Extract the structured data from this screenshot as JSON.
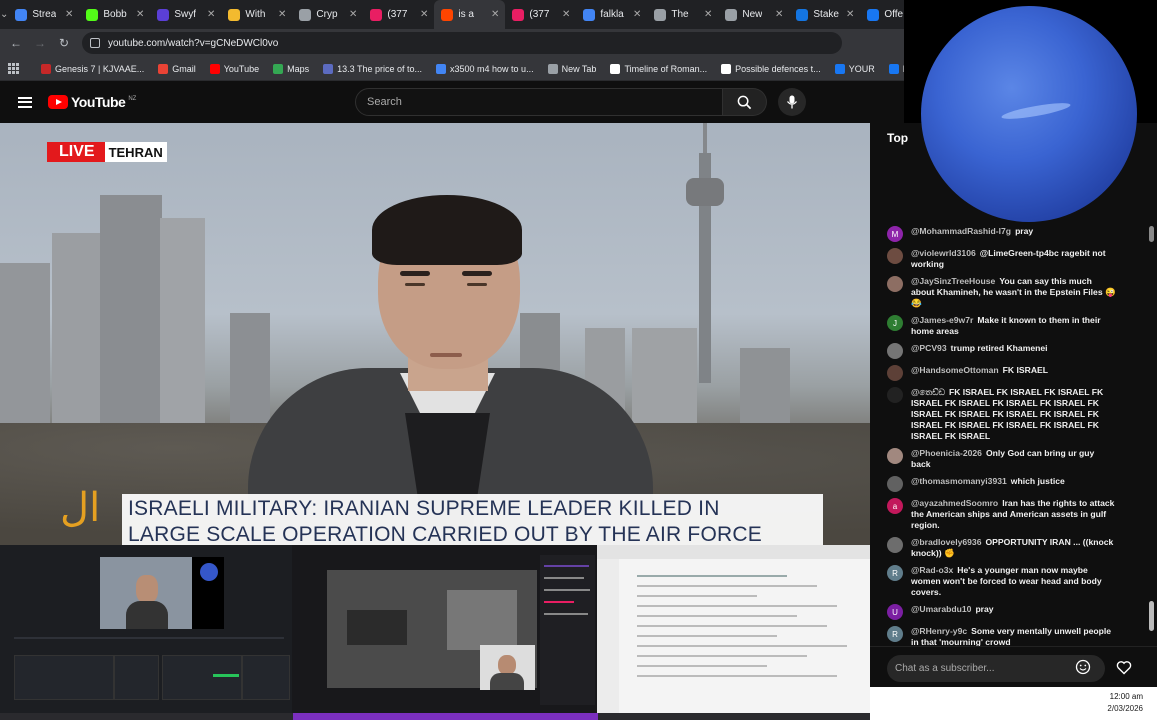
{
  "browser": {
    "tabs": [
      {
        "label": "Strea",
        "color": "#4285f4"
      },
      {
        "label": "Bobb",
        "color": "#53fc18"
      },
      {
        "label": "Swyf",
        "color": "#5b3fd6"
      },
      {
        "label": "With",
        "color": "#f3ba2f"
      },
      {
        "label": "Cryp",
        "color": "#9aa0a6"
      },
      {
        "label": "(377",
        "color": "#e91e63"
      },
      {
        "label": "is a",
        "color": "#ff4500"
      },
      {
        "label": "(377",
        "color": "#e91e63"
      },
      {
        "label": "falkla",
        "color": "#4285f4"
      },
      {
        "label": "The",
        "color": "#9aa0a6"
      },
      {
        "label": "New",
        "color": "#9aa0a6"
      },
      {
        "label": "Stake",
        "color": "#1475e1"
      },
      {
        "label": "Offe",
        "color": "#1877f2"
      }
    ],
    "url": "youtube.com/watch?v=gCNeDWCl0vo",
    "bookmarks": [
      {
        "label": "Genesis 7 | KJVAAE...",
        "color": "#c62828"
      },
      {
        "label": "Gmail",
        "color": "#ea4335"
      },
      {
        "label": "YouTube",
        "color": "#ff0000"
      },
      {
        "label": "Maps",
        "color": "#34a853"
      },
      {
        "label": "13.3 The price of to...",
        "color": "#5c6bc0"
      },
      {
        "label": "x3500 m4 how to u...",
        "color": "#4285f4"
      },
      {
        "label": "New Tab",
        "color": "#9aa0a6"
      },
      {
        "label": "Timeline of Roman...",
        "color": "#ffffff"
      },
      {
        "label": "Possible defences t...",
        "color": "#ffffff"
      },
      {
        "label": "YOUR",
        "color": "#1877f2"
      },
      {
        "label": "Facebook green",
        "color": "#1877f2"
      }
    ]
  },
  "youtube": {
    "logo_text": "YouTube",
    "country_code": "NZ",
    "search_placeholder": "Search"
  },
  "video": {
    "live_label": "LIVE",
    "location_label": "TEHRAN",
    "headline_line1": "ISRAELI MILITARY: IRANIAN SUPREME LEADER KILLED IN",
    "headline_line2": "LARGE SCALE OPERATION CARRIED OUT BY THE AIR FORCE"
  },
  "chat": {
    "header_label": "Top",
    "messages": [
      {
        "author": "@MohammadRashid-l7g",
        "text": "pray",
        "avatar": "M",
        "color": "#8e24aa"
      },
      {
        "author": "@violewrld3106",
        "text": "@LimeGreen-tp4bc ragebit not working",
        "avatar": "",
        "color": "#6d4c41"
      },
      {
        "author": "@JaySinzTreeHouse",
        "text": "You can say this much about Khamineh, he wasn't in the Epstein Files 😜 😂",
        "avatar": "",
        "color": "#8d6e63"
      },
      {
        "author": "@James-e9w7r",
        "text": "Make it known to them in their home areas",
        "avatar": "J",
        "color": "#2e7d32"
      },
      {
        "author": "@PCV93",
        "text": "trump retired Khamenei",
        "avatar": "",
        "color": "#757575"
      },
      {
        "author": "@HandsomeOttoman",
        "text": "FK ISRAEL",
        "avatar": "",
        "color": "#5d4037"
      },
      {
        "author": "@තෙඩ්ඩ",
        "text": "FK ISRAEL FK ISRAEL FK ISRAEL FK ISRAEL FK ISRAEL FK ISRAEL FK ISRAEL FK ISRAEL FK ISRAEL FK ISRAEL FK ISRAEL FK ISRAEL FK ISRAEL FK ISRAEL FK ISRAEL FK ISRAEL FK ISRAEL",
        "avatar": "",
        "color": "#222222"
      },
      {
        "author": "@Phoenicia-2026",
        "text": "Only God can bring ur guy back",
        "avatar": "",
        "color": "#a1887f"
      },
      {
        "author": "@thomasmomanyi3931",
        "text": "which justice",
        "avatar": "",
        "color": "#616161"
      },
      {
        "author": "@ayazahmedSoomro",
        "text": "Iran has the rights to attack the American ships and American assets in gulf region.",
        "avatar": "a",
        "color": "#c2185b"
      },
      {
        "author": "@bradlovely6936",
        "text": "OPPORTUNITY IRAN ... ((knock knock)) ✊",
        "avatar": "",
        "color": "#6d6d6d"
      },
      {
        "author": "@Rad-o3x",
        "text": "He's a younger man now maybe women won't be forced to wear head and body covers.",
        "avatar": "R",
        "color": "#607d8b"
      },
      {
        "author": "@Umarabdu10",
        "text": "pray",
        "avatar": "U",
        "color": "#7b1fa2"
      },
      {
        "author": "@RHenry-y9c",
        "text": "Some very mentally unwell people in that 'mourning' crowd",
        "avatar": "R",
        "color": "#607d8b"
      }
    ],
    "input_placeholder": "Chat as a subscriber..."
  },
  "taskbar": {
    "time": "12:00 am",
    "date": "2/03/2026"
  },
  "colors": {
    "youtube_red": "#ff0000",
    "live_red": "#e3191c",
    "headline_text": "#253356"
  },
  "icons": [
    "apps-icon",
    "back-icon",
    "forward-icon",
    "reload-icon",
    "site-info-icon",
    "menu-icon",
    "search-icon",
    "microphone-icon",
    "emoji-icon",
    "heart-icon"
  ]
}
